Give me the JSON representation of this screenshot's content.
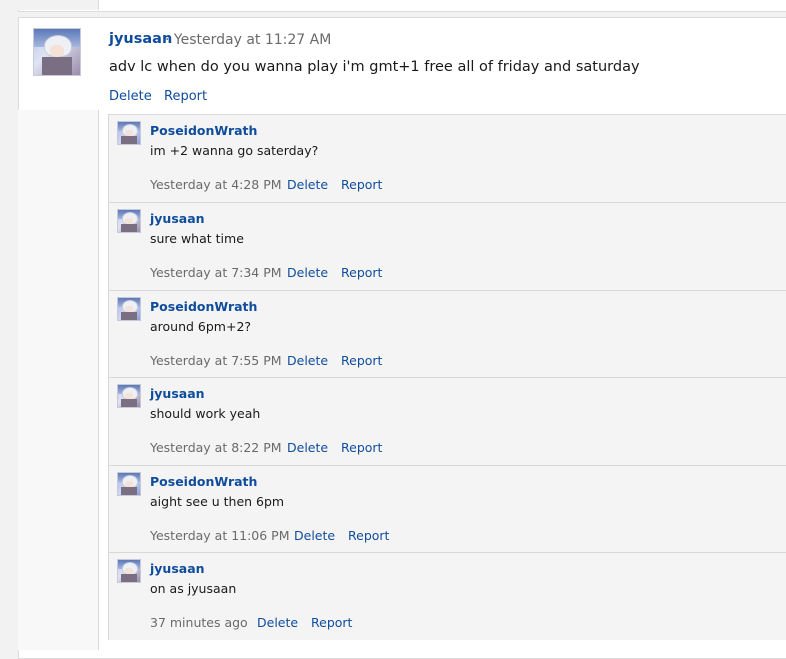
{
  "post": {
    "author": "jyusaan",
    "separator": "·",
    "timestamp": "Yesterday at 11:27 AM",
    "body": "adv lc when do you wanna play i'm gmt+1 free all of friday and saturday",
    "delete_label": "Delete",
    "report_label": "Report"
  },
  "replies": [
    {
      "author": "PoseidonWrath",
      "body": "im +2 wanna go saterday?",
      "timestamp": "Yesterday at 4:28 PM",
      "delete_label": "Delete",
      "report_label": "Report"
    },
    {
      "author": "jyusaan",
      "body": "sure what time",
      "timestamp": "Yesterday at 7:34 PM",
      "delete_label": "Delete",
      "report_label": "Report"
    },
    {
      "author": "PoseidonWrath",
      "body": "around 6pm+2?",
      "timestamp": "Yesterday at 7:55 PM",
      "delete_label": "Delete",
      "report_label": "Report"
    },
    {
      "author": "jyusaan",
      "body": "should work yeah",
      "timestamp": "Yesterday at 8:22 PM",
      "delete_label": "Delete",
      "report_label": "Report"
    },
    {
      "author": "PoseidonWrath",
      "body": "aight see u then 6pm",
      "timestamp": "Yesterday at 11:06 PM",
      "delete_label": "Delete",
      "report_label": "Report"
    },
    {
      "author": "jyusaan",
      "body": "on as jyusaan",
      "timestamp": "37 minutes ago",
      "delete_label": "Delete",
      "report_label": "Report"
    }
  ],
  "colors": {
    "link": "#0f4c9c",
    "muted": "#6a6a6a",
    "reply_bg": "#f4f4f4",
    "border": "#d8d8d8"
  }
}
